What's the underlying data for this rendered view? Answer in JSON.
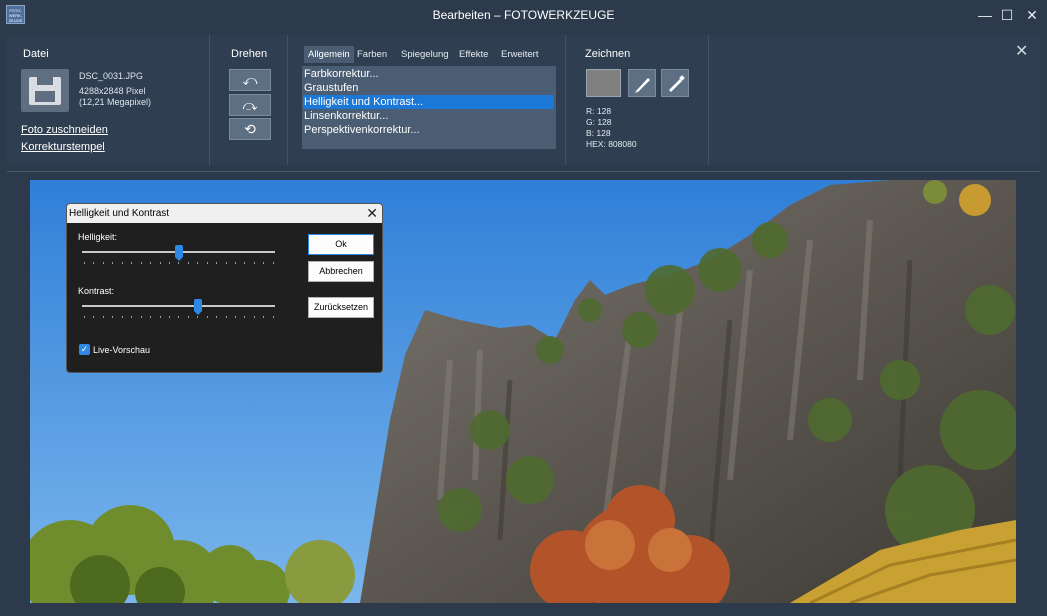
{
  "window": {
    "title": "Bearbeiten – FOTOWERKZEUGE",
    "app_icon_text": "FOTO-WERK-ZEUGE",
    "minimize_glyph": "—",
    "maximize_glyph": "☐",
    "close_glyph": "✕"
  },
  "ribbon": {
    "file": {
      "title": "Datei",
      "filename": "DSC_0031.JPG",
      "dimensions": "4288x2848 Pixel",
      "megapixels": "(12,21 Megapixel)",
      "crop_link": "Foto zuschneiden",
      "stamp_link": "Korrekturstempel"
    },
    "rotate": {
      "title": "Drehen",
      "buttons": [
        "⤺",
        "⤼",
        "⟲"
      ]
    },
    "tools": {
      "tabs": [
        "Allgemein",
        "Farben",
        "Spiegelung",
        "Effekte",
        "Erweitert"
      ],
      "active_tab": "Allgemein",
      "items": [
        "Farbkorrektur...",
        "Graustufen",
        "Helligkeit und Kontrast...",
        "Linsenkorrektur...",
        "Perspektivenkorrektur..."
      ],
      "selected_item": "Helligkeit und Kontrast..."
    },
    "draw": {
      "title": "Zeichnen",
      "color": "#808080",
      "r": "R: 128",
      "g": "G: 128",
      "b": "B: 128",
      "hex": "HEX: 808080"
    },
    "close_glyph": "✕"
  },
  "dialog": {
    "title": "Helligkeit und Kontrast",
    "close_glyph": "✕",
    "brightness_label": "Helligkeit:",
    "brightness_level": 0.5,
    "contrast_label": "Kontrast:",
    "contrast_level": 0.6,
    "ok_label": "Ok",
    "cancel_label": "Abbrechen",
    "reset_label": "Zurücksetzen",
    "live_preview_label": "Live-Vorschau",
    "live_preview_checked": true
  },
  "colors": {
    "accent": "#1c78d6",
    "background": "#2c3a4b"
  }
}
